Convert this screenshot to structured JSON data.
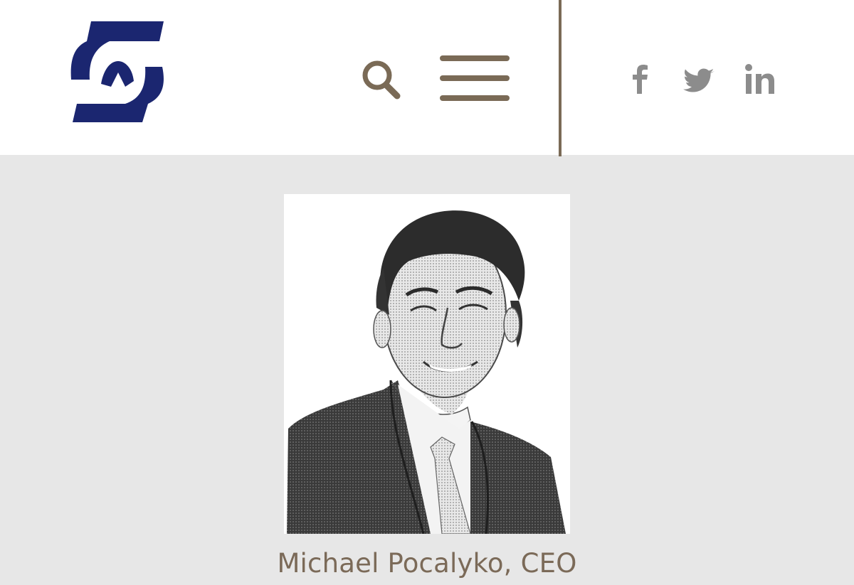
{
  "header": {
    "logo_icon": "company-s-logo-icon",
    "search_icon": "search-icon",
    "menu_icon": "hamburger-menu-icon",
    "social": [
      {
        "icon": "facebook-icon"
      },
      {
        "icon": "twitter-icon"
      },
      {
        "icon": "linkedin-icon"
      }
    ]
  },
  "profile": {
    "caption": "Michael Pocalyko, CEO"
  },
  "colors": {
    "brand_navy": "#1b2670",
    "accent_taupe": "#7a6a56",
    "social_gray": "#8c8c8c",
    "page_background": "#e7e7e7",
    "header_background": "#ffffff"
  }
}
